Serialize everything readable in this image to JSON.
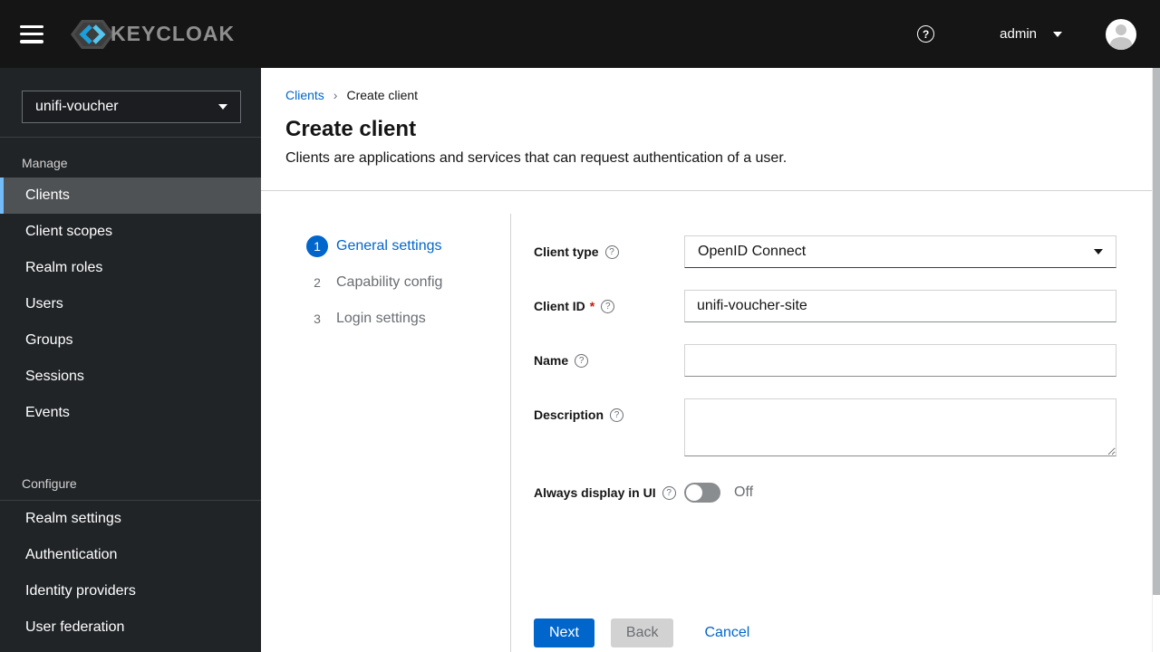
{
  "header": {
    "product": "KEYCLOAK",
    "user": "admin",
    "help_icon_glyph": "?"
  },
  "sidebar": {
    "realm_selector": {
      "value": "unifi-voucher"
    },
    "sections": [
      {
        "label": "Manage",
        "items": [
          {
            "label": "Clients",
            "active": true
          },
          {
            "label": "Client scopes"
          },
          {
            "label": "Realm roles"
          },
          {
            "label": "Users"
          },
          {
            "label": "Groups"
          },
          {
            "label": "Sessions"
          },
          {
            "label": "Events"
          }
        ]
      },
      {
        "label": "Configure",
        "items": [
          {
            "label": "Realm settings"
          },
          {
            "label": "Authentication"
          },
          {
            "label": "Identity providers"
          },
          {
            "label": "User federation"
          }
        ]
      }
    ]
  },
  "breadcrumb": {
    "link": "Clients",
    "separator": "›",
    "current": "Create client"
  },
  "page": {
    "title": "Create client",
    "subtitle": "Clients are applications and services that can request authentication of a user."
  },
  "wizard": {
    "steps": [
      {
        "num": "1",
        "label": "General settings",
        "active": true
      },
      {
        "num": "2",
        "label": "Capability config"
      },
      {
        "num": "3",
        "label": "Login settings"
      }
    ]
  },
  "form": {
    "client_type": {
      "label": "Client type",
      "value": "OpenID Connect"
    },
    "client_id": {
      "label": "Client ID",
      "required_mark": "*",
      "value": "unifi-voucher-site"
    },
    "name": {
      "label": "Name",
      "value": ""
    },
    "description": {
      "label": "Description",
      "value": ""
    },
    "always_display": {
      "label": "Always display in UI",
      "state": "Off"
    },
    "help_glyph": "?"
  },
  "footer": {
    "next": "Next",
    "back": "Back",
    "cancel": "Cancel"
  },
  "colors": {
    "accent_blue": "#0066cc",
    "active_nav_border": "#73bcf7",
    "masthead_bg": "#151515",
    "sidebar_bg": "#212427",
    "active_nav_bg": "#4f5255",
    "required_red": "#c9190b",
    "muted_gray": "#6a6e73",
    "toggle_off_bg": "#8a8d90"
  }
}
